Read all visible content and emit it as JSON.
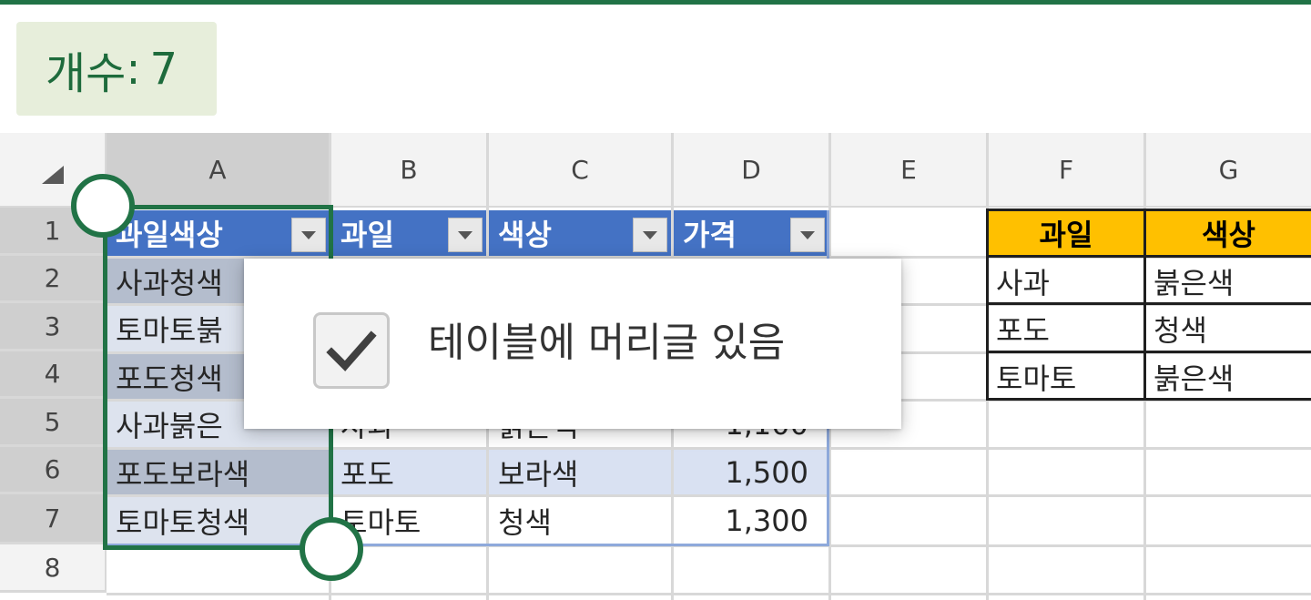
{
  "status": {
    "count_label": "개수",
    "separator": ":",
    "count_value": "7"
  },
  "columns": [
    "A",
    "B",
    "C",
    "D",
    "E",
    "F",
    "G"
  ],
  "rows": [
    "1",
    "2",
    "3",
    "4",
    "5",
    "6",
    "7",
    "8"
  ],
  "table": {
    "headers": [
      "과일색상",
      "과일",
      "색상",
      "가격"
    ],
    "col_a": [
      "사과청색",
      "토마토붉",
      "포도청색",
      "사과붉은",
      "포도보라색",
      "토마토청색"
    ],
    "row5": {
      "b": "사과",
      "c": "붉은색",
      "d": "1,100"
    },
    "row6": {
      "b": "포도",
      "c": "보라색",
      "d": "1,500"
    },
    "row7": {
      "b": "토마토",
      "c": "청색",
      "d": "1,300"
    }
  },
  "lookup": {
    "headers": [
      "과일",
      "색상"
    ],
    "rows": [
      [
        "사과",
        "붉은색"
      ],
      [
        "포도",
        "청색"
      ],
      [
        "토마토",
        "붉은색"
      ]
    ]
  },
  "popup": {
    "checkbox_label": "테이블에 머리글 있음",
    "checked": true
  },
  "colors": {
    "accent": "#217346",
    "table_header": "#4472c4",
    "band": "#d9e1f2",
    "lookup_header": "#ffc000"
  }
}
